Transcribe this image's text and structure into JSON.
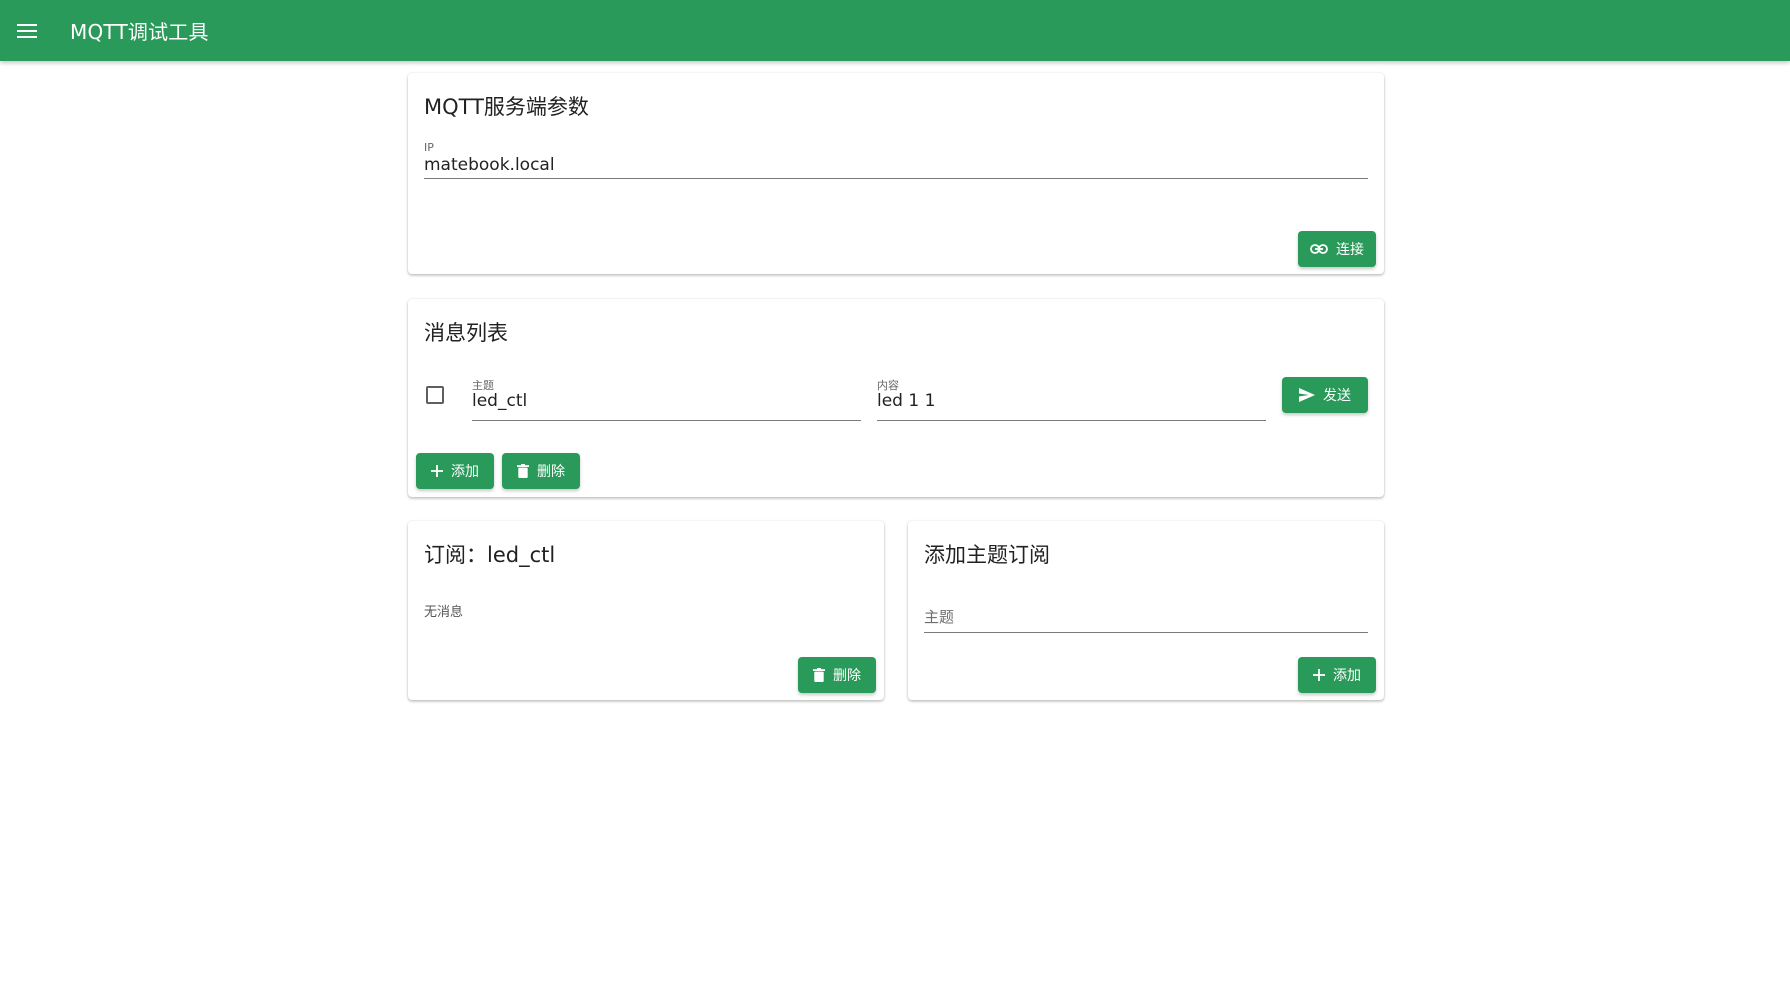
{
  "app": {
    "title": "MQTT调试工具"
  },
  "colors": {
    "primary": "#2a9a5a",
    "on_primary": "#ffffff"
  },
  "icons": {
    "menu": "menu-icon",
    "connect": "link-icon",
    "send": "send-icon",
    "add": "plus-icon",
    "delete": "trash-icon"
  },
  "server_card": {
    "title": "MQTT服务端参数",
    "ip_label": "IP",
    "ip_value": "matebook.local",
    "connect_label": "连接"
  },
  "message_card": {
    "title": "消息列表",
    "items": [
      {
        "topic_label": "主题",
        "topic_value": "led_ctl",
        "content_label": "内容",
        "content_value": "led 1 1",
        "send_label": "发送",
        "checked": false
      }
    ],
    "add_label": "添加",
    "delete_label": "删除"
  },
  "subscription_card": {
    "title": "订阅：led_ctl",
    "empty_text": "无消息",
    "delete_label": "删除"
  },
  "add_subscription_card": {
    "title": "添加主题订阅",
    "topic_placeholder": "主题",
    "add_label": "添加"
  }
}
